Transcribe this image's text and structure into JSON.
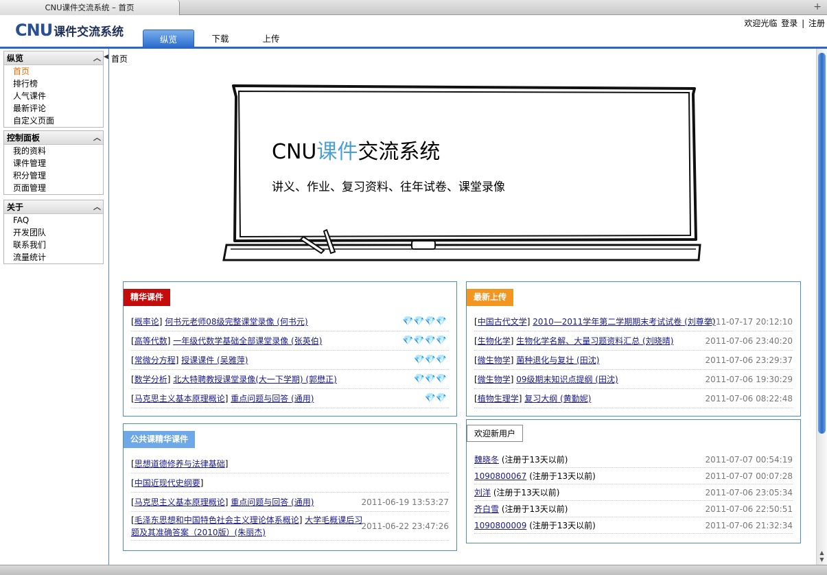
{
  "window": {
    "title": "CNU课件交流系统 – 首页"
  },
  "header": {
    "logo_cnu": "CNU",
    "logo_text": "课件交流系统",
    "welcome": "欢迎光临",
    "login": "登录",
    "separator": "|",
    "register": "注册",
    "tabs": [
      {
        "label": "纵览"
      },
      {
        "label": "下载"
      },
      {
        "label": "上传"
      }
    ]
  },
  "sidebar": {
    "sections": [
      {
        "title": "纵览",
        "items": [
          "首页",
          "排行榜",
          "人气课件",
          "最新评论",
          "自定义页面"
        ]
      },
      {
        "title": "控制面板",
        "items": [
          "我的资料",
          "课件管理",
          "积分管理",
          "页面管理"
        ]
      },
      {
        "title": "关于",
        "items": [
          "FAQ",
          "开发团队",
          "联系我们",
          "流量统计"
        ]
      }
    ]
  },
  "breadcrumb": "首页",
  "banner": {
    "title_cnu": "CNU",
    "title_blue": "课件",
    "title_rest": "交流系统",
    "subtitle": "讲义、作业、复习资料、往年试卷、课堂录像"
  },
  "featured": {
    "title": "精华课件",
    "items": [
      {
        "category": "概率论",
        "title": "何书元老师08级完整课堂录像 (何书元)",
        "gems": "💎💎💎💎"
      },
      {
        "category": "高等代数",
        "title": "一年级代数学基础全部课堂录像 (张英伯)",
        "gems": "💎💎💎💎"
      },
      {
        "category": "常微分方程",
        "title": "授课课件 (吴雅萍)",
        "gems": "💎💎💎"
      },
      {
        "category": "数学分析",
        "title": "北大特聘教授课堂录像(大一下学期) (郭懋正)",
        "gems": "💎💎💎"
      },
      {
        "category": "马克思主义基本原理概论",
        "title": "重点问题与回答 (通用)",
        "gems": "💎💎"
      }
    ]
  },
  "latest": {
    "title": "最新上传",
    "items": [
      {
        "category": "中国古代文学",
        "title": "2010—2011学年第二学期期末考试试卷 (刘尊举)",
        "time": "2011-07-17 20:12:10"
      },
      {
        "category": "生物化学",
        "title": "生物化学名解、大量习题资料汇总 (刘晓晴)",
        "time": "2011-07-06 23:40:20"
      },
      {
        "category": "微生物学",
        "title": "菌种退化与复壮 (田沈)",
        "time": "2011-07-06 23:29:37"
      },
      {
        "category": "微生物学",
        "title": "09级期末知识点提纲 (田沈)",
        "time": "2011-07-06 19:30:29"
      },
      {
        "category": "植物生理学",
        "title": "复习大纲 (黄勤妮)",
        "time": "2011-07-06 08:22:48"
      }
    ]
  },
  "public": {
    "title": "公共课精华课件",
    "items": [
      {
        "category": "思想道德修养与法律基础",
        "title": "",
        "time": ""
      },
      {
        "category": "中国近现代史纲要",
        "title": "",
        "time": ""
      },
      {
        "category": "马克思主义基本原理概论",
        "title": "重点问题与回答 (通用)",
        "time": "2011-06-19 13:53:27"
      },
      {
        "category": "毛泽东思想和中国特色社会主义理论体系概论",
        "title": "大学毛概课后习题及其准确答案（2010版）(朱丽杰)",
        "time": "2011-06-22 23:47:26"
      }
    ]
  },
  "newusers": {
    "title": "欢迎新用户",
    "items": [
      {
        "name": "魏晓冬",
        "note": "(注册于13天以前)",
        "time": "2011-07-07 00:54:19"
      },
      {
        "name": "1090800067",
        "note": "(注册于13天以前)",
        "time": "2011-07-07 00:07:28"
      },
      {
        "name": "刘洋",
        "note": "(注册于13天以前)",
        "time": "2011-07-06 23:05:34"
      },
      {
        "name": "齐白雪",
        "note": "(注册于13天以前)",
        "time": "2011-07-06 22:50:51"
      },
      {
        "name": "1090800009",
        "note": "(注册于13天以前)",
        "time": "2011-07-06 21:32:34"
      }
    ]
  },
  "colors": {
    "accent": "#2b66c7",
    "featured_tag": "#c40c0c",
    "latest_tag": "#f39521",
    "public_tag": "#6ea8e6",
    "gem": "#2aa9d8"
  }
}
